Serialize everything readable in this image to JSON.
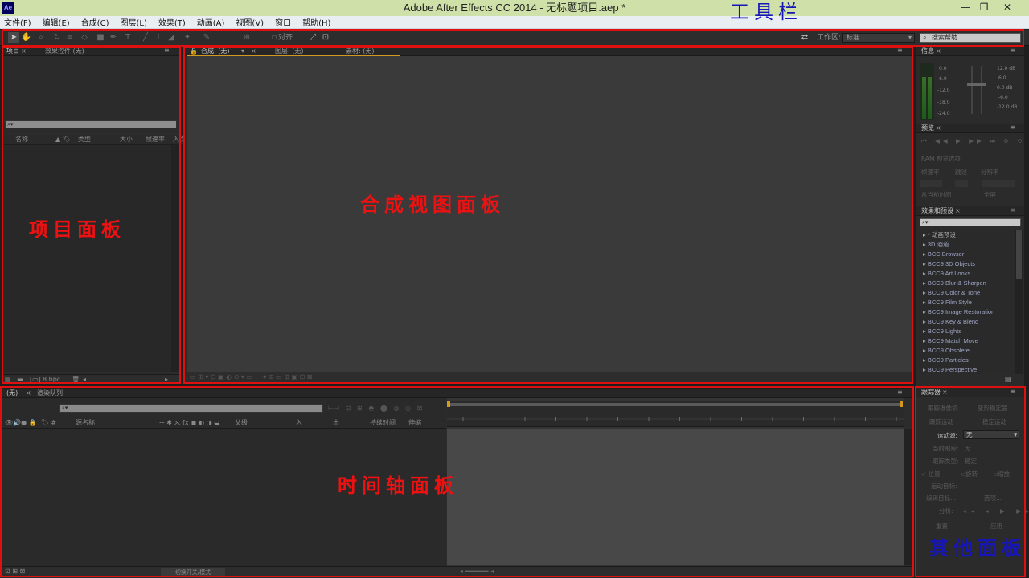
{
  "window": {
    "app_icon": "Ae",
    "title": "Adobe After Effects CC 2014 - 无标题项目.aep *",
    "minimize": "—",
    "maximize": "❐",
    "close": "✕"
  },
  "menu": [
    "文件(F)",
    "编辑(E)",
    "合成(C)",
    "图层(L)",
    "效果(T)",
    "动画(A)",
    "视图(V)",
    "窗口",
    "帮助(H)"
  ],
  "toolbar": {
    "tools": [
      "selection-tool",
      "hand-tool",
      "zoom-tool",
      "rotate-tool",
      "orbit-camera-tool",
      "pan-behind-tool",
      "rectangle-tool",
      "pen-tool",
      "type-tool",
      "brush-tool",
      "clone-stamp-tool",
      "eraser-tool",
      "roto-brush-tool",
      "puppet-pin-tool"
    ],
    "snap_label": "对齐",
    "workspace_label": "工作区:",
    "workspace_value": "标准",
    "help_search_placeholder": "搜索帮助"
  },
  "project_panel": {
    "tab_project": "项目",
    "tab_effect_controls": "效果控件 (无)",
    "columns": [
      "名称",
      "类型",
      "大小",
      "帧速率",
      "入点"
    ],
    "bpc": "8 bpc"
  },
  "comp_panel": {
    "tab_composition": "合成: (无)",
    "tab_layer": "图层: (无)",
    "tab_footage": "素材: (无)"
  },
  "timeline_panel": {
    "tab_none": "(无)",
    "tab_render_queue": "渲染队列",
    "columns": [
      "源名称",
      "父级",
      "入",
      "出",
      "持续时间",
      "伸缩"
    ],
    "toggle_label": "切换开关/模式"
  },
  "right_dock": {
    "info_tab": "信息",
    "audio_levels": [
      "0.0",
      "-6.0",
      "-12.0",
      "-18.0",
      "-24.0"
    ],
    "audio_db": [
      "12.0 dB",
      "6.0",
      "0.0 dB",
      "-6.0",
      "-12.0 dB"
    ],
    "preview_tab": "预览",
    "preview_ram": "RAM 预览选项",
    "preview_fps_label": "帧速率",
    "preview_skip_label": "跳过",
    "preview_res_label": "分辨率",
    "preview_from_current": "从当前时间",
    "preview_fullscreen": "全屏",
    "effects_tab": "效果和预设",
    "effects_items": [
      "* 动画预设",
      "3D 通道",
      "BCC Browser",
      "BCC9 3D Objects",
      "BCC9 Art Looks",
      "BCC9 Blur & Sharpen",
      "BCC9 Color & Tone",
      "BCC9 Film Style",
      "BCC9 Image Restoration",
      "BCC9 Key & Blend",
      "BCC9 Lights",
      "BCC9 Match Move",
      "BCC9 Obsolete",
      "BCC9 Particles",
      "BCC9 Perspective"
    ],
    "tracker_tab": "跟踪器",
    "tracker_track_camera": "跟踪摄像机",
    "tracker_warp_stabilizer": "变形稳定器",
    "tracker_track_motion": "跟踪运动",
    "tracker_stabilize_motion": "稳定运动",
    "tracker_source_label": "运动源:",
    "tracker_source_value": "无",
    "tracker_current_track": "当前跟踪:",
    "tracker_current_track_value": "无",
    "tracker_type_label": "跟踪类型:",
    "tracker_type_value": "稳定",
    "tracker_position": "位置",
    "tracker_rotation": "旋转",
    "tracker_scale": "缩放",
    "tracker_motion_target": "运动目标:",
    "tracker_edit_target": "编辑目标...",
    "tracker_options": "选项...",
    "tracker_analyze": "分析:",
    "tracker_reset": "重置",
    "tracker_apply": "应用"
  },
  "annotations": {
    "toolbar": "工具栏",
    "project": "项目面板",
    "comp": "合成视图面板",
    "timeline": "时间轴面板",
    "other": "其他面板"
  },
  "colors": {
    "annotation_red": "#ee1111",
    "annotation_blue": "#1616b8",
    "title_bar": "#cfe1a8",
    "work_area_orange": "#d29a1c"
  }
}
